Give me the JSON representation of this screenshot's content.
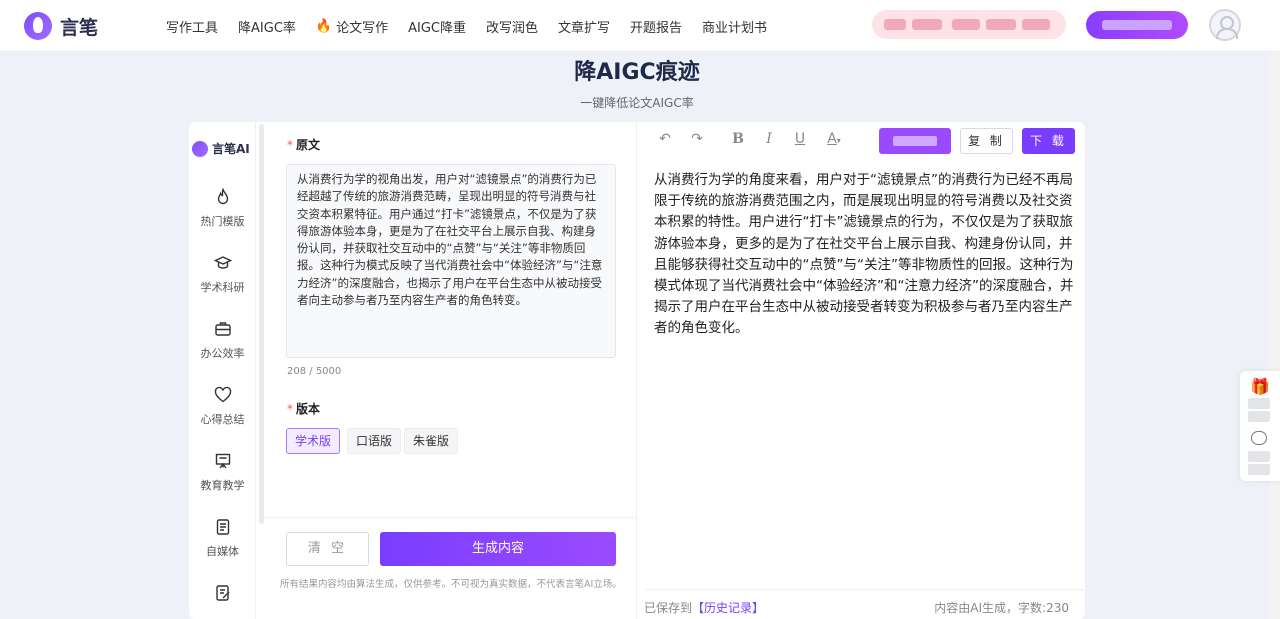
{
  "header": {
    "brand": "言笔",
    "nav": [
      {
        "label": "写作工具",
        "icon": ""
      },
      {
        "label": "降AIGC率",
        "icon": ""
      },
      {
        "label": "论文写作",
        "icon": "fire-icon"
      },
      {
        "label": "AIGC降重",
        "icon": ""
      },
      {
        "label": "改写润色",
        "icon": ""
      },
      {
        "label": "文章扩写",
        "icon": ""
      },
      {
        "label": "开题报告",
        "icon": ""
      },
      {
        "label": "商业计划书",
        "icon": ""
      }
    ]
  },
  "page": {
    "title": "降AIGC痕迹",
    "subtitle": "一键降低论文AIGC率"
  },
  "sidebar": {
    "brand": "言笔AI",
    "items": [
      {
        "label": "热门模版",
        "icon": "fire-icon"
      },
      {
        "label": "学术科研",
        "icon": "graduation-cap-icon"
      },
      {
        "label": "办公效率",
        "icon": "briefcase-icon"
      },
      {
        "label": "心得总结",
        "icon": "heart-icon"
      },
      {
        "label": "教育教学",
        "icon": "presentation-board-icon"
      },
      {
        "label": "自媒体",
        "icon": "document-icon"
      }
    ]
  },
  "input": {
    "source_label": "原文",
    "source_text": "从消费行为学的视角出发，用户对“滤镜景点”的消费行为已经超越了传统的旅游消费范畴，呈现出明显的符号消费与社交资本积累特征。用户通过“打卡”滤镜景点，不仅是为了获得旅游体验本身，更是为了在社交平台上展示自我、构建身份认同，并获取社交互动中的“点赞”与“关注”等非物质回报。这种行为模式反映了当代消费社会中“体验经济”与“注意力经济”的深度融合，也揭示了用户在平台生态中从被动接受者向主动参与者乃至内容生产者的角色转变。",
    "counter": "208 / 5000",
    "version_label": "版本",
    "versions": [
      "学术版",
      "口语版",
      "朱雀版"
    ],
    "selected_version": "学术版",
    "clear_label": "清 空",
    "generate_label": "生成内容",
    "disclaimer": "所有结果内容均由算法生成，仅供参考。不可视为真实数据，不代表言笔AI立场。"
  },
  "output": {
    "toolbar_icons": [
      "undo-icon",
      "redo-icon",
      "bold-icon",
      "italic-icon",
      "underline-icon",
      "font-color-icon"
    ],
    "copy_label": "复 制",
    "download_label": "下 载",
    "text": "从消费行为学的角度来看，用户对于“滤镜景点”的消费行为已经不再局限于传统的旅游消费范围之内，而是展现出明显的符号消费以及社交资本积累的特性。用户进行“打卡”滤镜景点的行为，不仅仅是为了获取旅游体验本身，更多的是为了在社交平台上展示自我、构建身份认同，并且能够获得社交互动中的“点赞”与“关注”等非物质性的回报。这种行为模式体现了当代消费社会中“体验经济”和“注意力经济”的深度融合，并揭示了用户在平台生态中从被动接受者转变为积极参与者乃至内容生产者的角色变化。",
    "saved_prefix": "已保存到",
    "history_link": "【历史记录】",
    "status": "内容由AI生成，字数:230"
  },
  "colors": {
    "accent": "#7a3dff",
    "required_star": "#f25b5b"
  }
}
